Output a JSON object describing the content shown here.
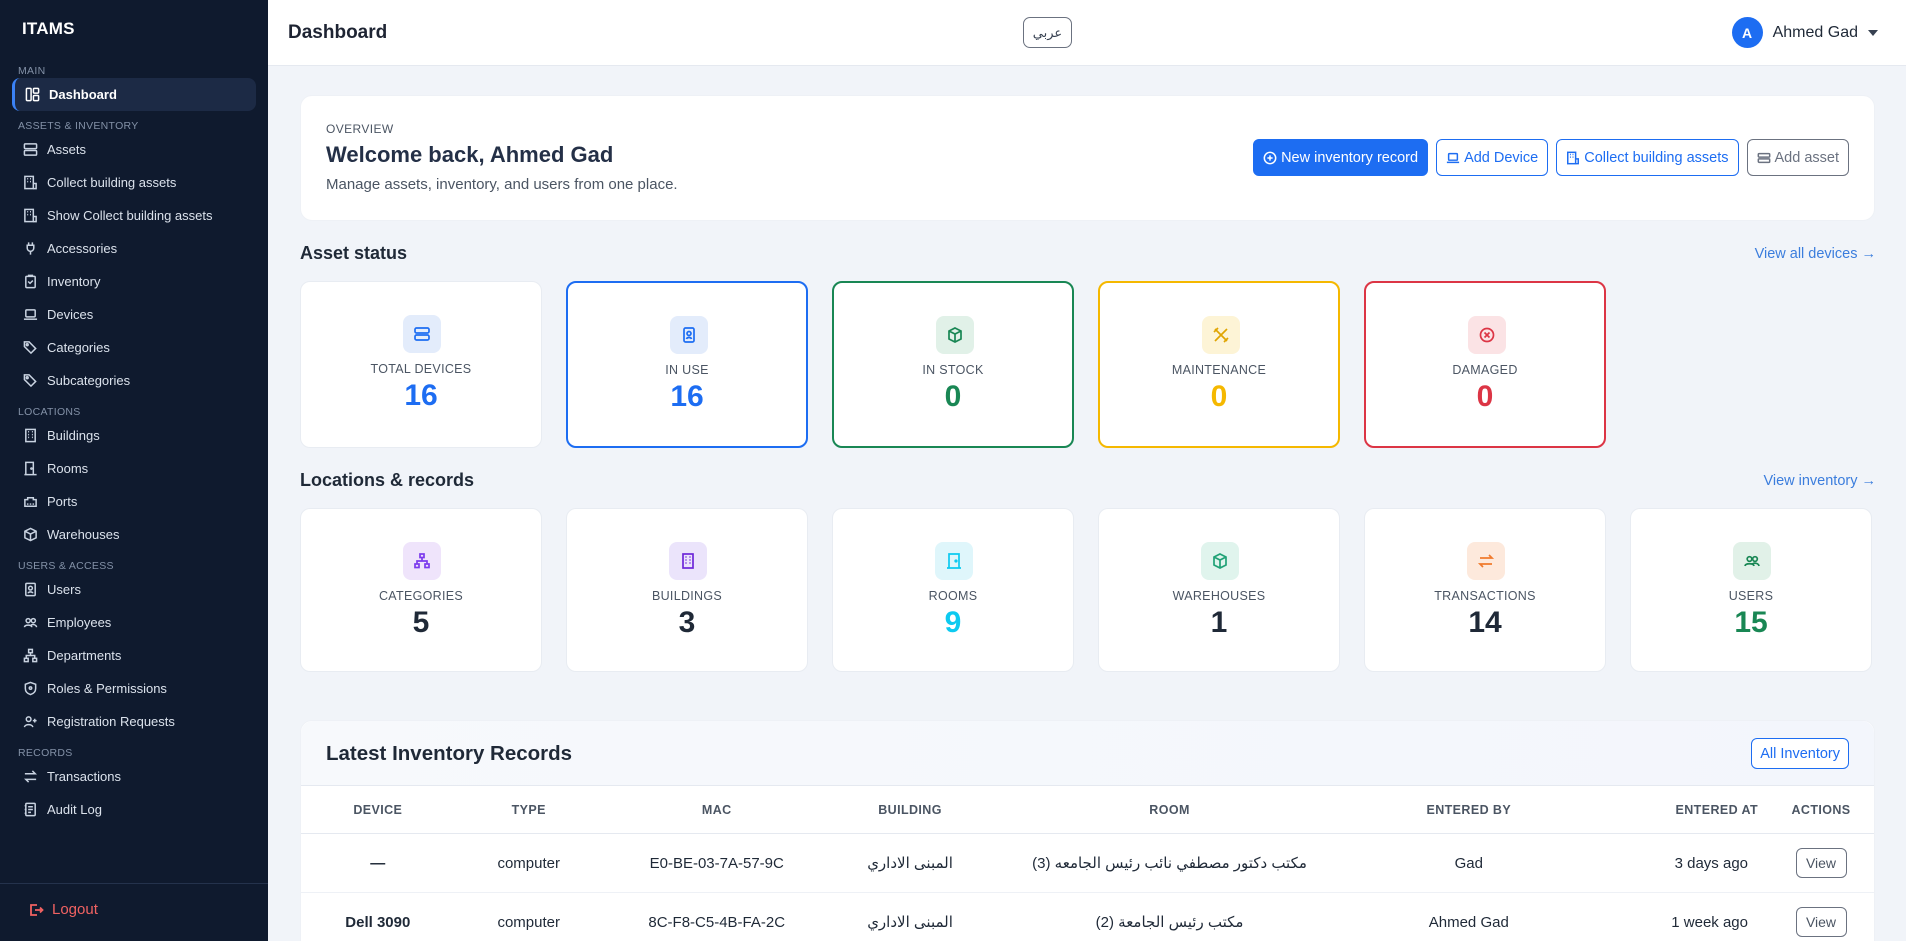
{
  "sidebar": {
    "brand": "ITAMS",
    "sections": [
      {
        "title": "MAIN",
        "items": [
          {
            "label": "Dashboard",
            "icon": "dashboard-icon",
            "active": true
          }
        ]
      },
      {
        "title": "ASSETS & INVENTORY",
        "items": [
          {
            "label": "Assets",
            "icon": "assets-icon"
          },
          {
            "label": "Collect building assets",
            "icon": "building-collect-icon"
          },
          {
            "label": "Show Collect building assets",
            "icon": "building-collect-icon"
          },
          {
            "label": "Accessories",
            "icon": "plug-icon"
          },
          {
            "label": "Inventory",
            "icon": "clipboard-icon"
          },
          {
            "label": "Devices",
            "icon": "laptop-icon"
          },
          {
            "label": "Categories",
            "icon": "tags-icon"
          },
          {
            "label": "Subcategories",
            "icon": "tags-icon"
          }
        ]
      },
      {
        "title": "LOCATIONS",
        "items": [
          {
            "label": "Buildings",
            "icon": "building-icon"
          },
          {
            "label": "Rooms",
            "icon": "door-icon"
          },
          {
            "label": "Ports",
            "icon": "ethernet-icon"
          },
          {
            "label": "Warehouses",
            "icon": "box-icon"
          }
        ]
      },
      {
        "title": "USERS & ACCESS",
        "items": [
          {
            "label": "Users",
            "icon": "id-badge-icon"
          },
          {
            "label": "Employees",
            "icon": "people-icon"
          },
          {
            "label": "Departments",
            "icon": "sitemap-icon"
          },
          {
            "label": "Roles & Permissions",
            "icon": "shield-icon"
          },
          {
            "label": "Registration Requests",
            "icon": "person-plus-icon"
          }
        ]
      },
      {
        "title": "RECORDS",
        "items": [
          {
            "label": "Transactions",
            "icon": "swap-icon"
          },
          {
            "label": "Audit Log",
            "icon": "journal-icon"
          }
        ]
      }
    ],
    "logout": "Logout"
  },
  "topbar": {
    "title": "Dashboard",
    "lang_button": "عربي",
    "user_initial": "A",
    "user_name": "Ahmed Gad"
  },
  "overview": {
    "eyebrow": "OVERVIEW",
    "title": "Welcome back, Ahmed Gad",
    "subtitle": "Manage assets, inventory, and users from one place.",
    "actions": {
      "new_record": "New inventory record",
      "add_device": "Add Device",
      "collect": "Collect building assets",
      "add_asset": "Add asset"
    }
  },
  "asset_status": {
    "title": "Asset status",
    "link": "View all devices →",
    "cards": [
      {
        "label": "TOTAL DEVICES",
        "value": "16",
        "color": "#1d6df2"
      },
      {
        "label": "IN USE",
        "value": "16",
        "color": "#1d6df2"
      },
      {
        "label": "IN STOCK",
        "value": "0",
        "color": "#198754"
      },
      {
        "label": "MAINTENANCE",
        "value": "0",
        "color": "#f5b800"
      },
      {
        "label": "DAMAGED",
        "value": "0",
        "color": "#dc3545"
      }
    ]
  },
  "locations": {
    "title": "Locations & records",
    "link": "View inventory →",
    "cards": [
      {
        "label": "CATEGORIES",
        "value": "5",
        "color": "#1f2937"
      },
      {
        "label": "BUILDINGS",
        "value": "3",
        "color": "#1f2937"
      },
      {
        "label": "ROOMS",
        "value": "9",
        "color": "#0dcaf0"
      },
      {
        "label": "WAREHOUSES",
        "value": "1",
        "color": "#1f2937"
      },
      {
        "label": "TRANSACTIONS",
        "value": "14",
        "color": "#1f2937"
      },
      {
        "label": "USERS",
        "value": "15",
        "color": "#198754"
      }
    ]
  },
  "latest": {
    "title": "Latest Inventory Records",
    "button": "All Inventory",
    "columns": [
      "DEVICE",
      "TYPE",
      "MAC",
      "BUILDING",
      "ROOM",
      "ENTERED BY",
      "ENTERED AT",
      "ACTIONS"
    ],
    "rows": [
      {
        "device": "—",
        "type": "computer",
        "mac": "E0-BE-03-7A-57-9C",
        "building": "المبنى الاداري",
        "room": "مكتب دكتور مصطفي نائب رئيس الجامعه (3)",
        "entered_by": "Gad",
        "entered_at": "3 days ago",
        "action": "View"
      },
      {
        "device": "Dell 3090",
        "type": "computer",
        "mac": "8C-F8-C5-4B-FA-2C",
        "building": "المبنى الاداري",
        "room": "مكتب رئيس الجامعة (2)",
        "entered_by": "Ahmed Gad",
        "entered_at": "1 week ago",
        "action": "View"
      }
    ]
  }
}
